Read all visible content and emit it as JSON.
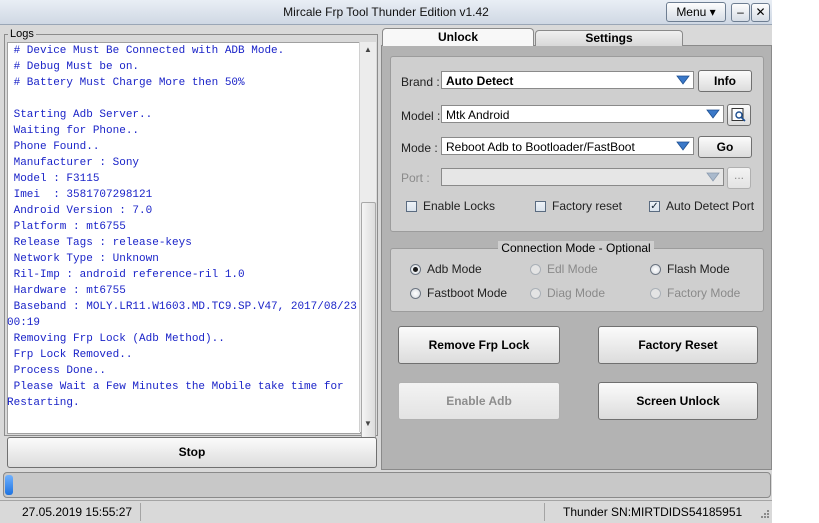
{
  "window": {
    "title": "Mircale Frp Tool Thunder Edition v1.42",
    "menu_label": "Menu ▾",
    "minimize": "–",
    "close": "✕"
  },
  "logs": {
    "legend": "Logs",
    "lines": [
      " # Device Must Be Connected with ADB Mode.",
      " # Debug Must be on.",
      " # Battery Must Charge More then 50%",
      "",
      " Starting Adb Server..",
      " Waiting for Phone..",
      " Phone Found..",
      " Manufacturer : Sony",
      " Model : F3115",
      " Imei  : 3581707298121",
      " Android Version : 7.0",
      " Platform : mt6755",
      " Release Tags : release-keys",
      " Network Type : Unknown",
      " Ril-Imp : android reference-ril 1.0",
      " Hardware : mt6755",
      " Baseband : MOLY.LR11.W1603.MD.TC9.SP.V47, 2017/08/23",
      "00:19",
      " Removing Frp Lock (Adb Method)..",
      " Frp Lock Removed..",
      " Process Done..",
      " Please Wait a Few Minutes the Mobile take time for",
      "Restarting."
    ],
    "stop_label": "Stop"
  },
  "tabs": {
    "unlock": "Unlock",
    "settings": "Settings"
  },
  "form": {
    "brand_label": "Brand :",
    "brand_value": "Auto Detect",
    "info_label": "Info",
    "model_label": "Model :",
    "model_value": "Mtk Android",
    "mode_label": "Mode :",
    "mode_value": "Reboot Adb to Bootloader/FastBoot",
    "go_label": "Go",
    "port_label": "Port :",
    "port_value": "",
    "browse_label": "...",
    "enable_locks": "Enable Locks",
    "factory_reset_chk": "Factory reset",
    "auto_detect_port": "Auto Detect Port",
    "auto_detect_port_checked": "✓"
  },
  "connection": {
    "legend": "Connection Mode - Optional",
    "adb": "Adb Mode",
    "edl": "Edl Mode",
    "flash": "Flash Mode",
    "fastboot": "Fastboot Mode",
    "diag": "Diag Mode",
    "factory": "Factory Mode"
  },
  "actions": {
    "remove_frp": "Remove Frp Lock",
    "factory_reset": "Factory Reset",
    "enable_adb": "Enable Adb",
    "screen_unlock": "Screen Unlock"
  },
  "progress": {
    "value": 0.01
  },
  "status": {
    "datetime": "27.05.2019 15:55:27",
    "serial": "Thunder SN:MIRTDIDS54185951"
  },
  "colors": {
    "log_text": "#1a23c8",
    "progress_fill": "#1f73e0",
    "dropdown_arrow": "#3a78c8"
  }
}
